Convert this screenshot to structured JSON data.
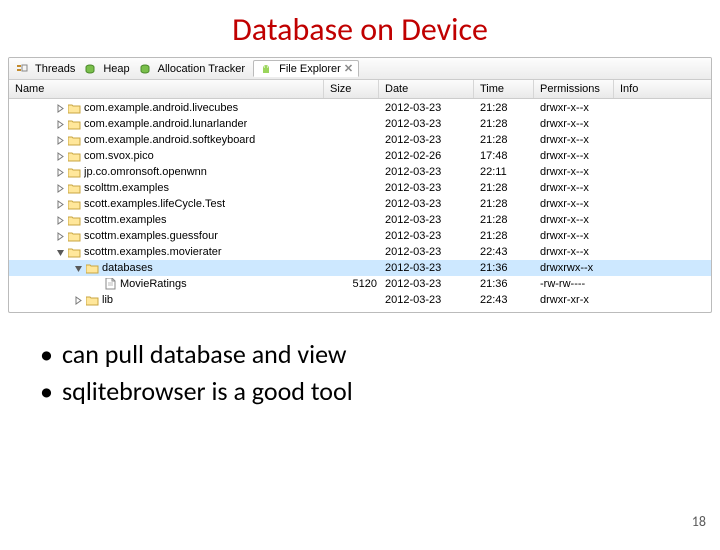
{
  "title": "Database on Device",
  "tabs": {
    "threads": "Threads",
    "heap": "Heap",
    "alloc": "Allocation Tracker",
    "fileexp": "File Explorer"
  },
  "columns": {
    "name": "Name",
    "size": "Size",
    "date": "Date",
    "time": "Time",
    "perm": "Permissions",
    "info": "Info"
  },
  "rows": [
    {
      "depth": 0,
      "icon": "folder",
      "expander": "closed",
      "label": "com.example.android.livecubes",
      "size": "",
      "date": "2012-03-23",
      "time": "21:28",
      "perm": "drwxr-x--x"
    },
    {
      "depth": 0,
      "icon": "folder",
      "expander": "closed",
      "label": "com.example.android.lunarlander",
      "size": "",
      "date": "2012-03-23",
      "time": "21:28",
      "perm": "drwxr-x--x"
    },
    {
      "depth": 0,
      "icon": "folder",
      "expander": "closed",
      "label": "com.example.android.softkeyboard",
      "size": "",
      "date": "2012-03-23",
      "time": "21:28",
      "perm": "drwxr-x--x"
    },
    {
      "depth": 0,
      "icon": "folder",
      "expander": "closed",
      "label": "com.svox.pico",
      "size": "",
      "date": "2012-02-26",
      "time": "17:48",
      "perm": "drwxr-x--x"
    },
    {
      "depth": 0,
      "icon": "folder",
      "expander": "closed",
      "label": "jp.co.omronsoft.openwnn",
      "size": "",
      "date": "2012-03-23",
      "time": "22:11",
      "perm": "drwxr-x--x"
    },
    {
      "depth": 0,
      "icon": "folder",
      "expander": "closed",
      "label": "scolttm.examples",
      "size": "",
      "date": "2012-03-23",
      "time": "21:28",
      "perm": "drwxr-x--x"
    },
    {
      "depth": 0,
      "icon": "folder",
      "expander": "closed",
      "label": "scott.examples.lifeCycle.Test",
      "size": "",
      "date": "2012-03-23",
      "time": "21:28",
      "perm": "drwxr-x--x"
    },
    {
      "depth": 0,
      "icon": "folder",
      "expander": "closed",
      "label": "scottm.examples",
      "size": "",
      "date": "2012-03-23",
      "time": "21:28",
      "perm": "drwxr-x--x"
    },
    {
      "depth": 0,
      "icon": "folder",
      "expander": "closed",
      "label": "scottm.examples.guessfour",
      "size": "",
      "date": "2012-03-23",
      "time": "21:28",
      "perm": "drwxr-x--x"
    },
    {
      "depth": 0,
      "icon": "folder",
      "expander": "open",
      "label": "scottm.examples.movierater",
      "size": "",
      "date": "2012-03-23",
      "time": "22:43",
      "perm": "drwxr-x--x"
    },
    {
      "depth": 1,
      "icon": "folder",
      "expander": "open",
      "label": "databases",
      "size": "",
      "date": "2012-03-23",
      "time": "21:36",
      "perm": "drwxrwx--x",
      "selected": true
    },
    {
      "depth": 2,
      "icon": "file",
      "expander": "none",
      "label": "MovieRatings",
      "size": "5120",
      "date": "2012-03-23",
      "time": "21:36",
      "perm": "-rw-rw----"
    },
    {
      "depth": 1,
      "icon": "folder",
      "expander": "closed",
      "label": "lib",
      "size": "",
      "date": "2012-03-23",
      "time": "22:43",
      "perm": "drwxr-xr-x"
    }
  ],
  "bullets": [
    "can pull database and view",
    "sqlitebrowser is a good tool"
  ],
  "pageNumber": "18"
}
